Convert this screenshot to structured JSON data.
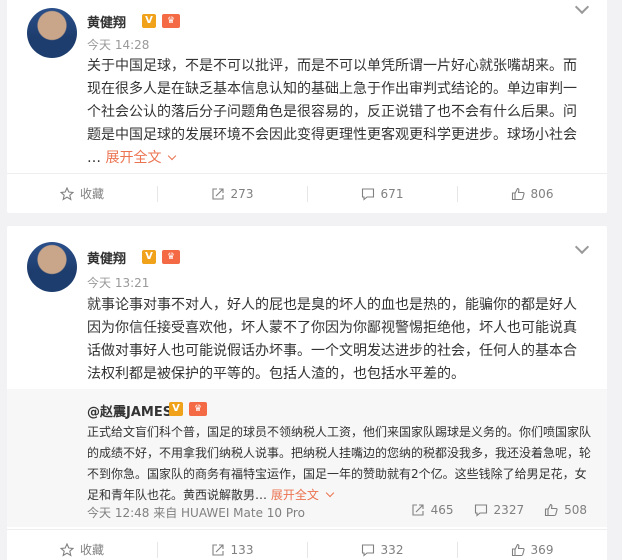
{
  "posts": [
    {
      "author": "黄健翔",
      "verified_badge": "V",
      "level_badge": "♛",
      "time": "今天 14:28",
      "content": "关于中国足球，不是不可以批评，而是不可以单凭所谓一片好心就张嘴胡来。而现在很多人是在缺乏基本信息认知的基础上急于作出审判式结论的。单边审判一个社会公认的落后分子问题角色是很容易的，反正说错了也不会有什么后果。问题是中国足球的发展环境不会因此变得更理性更客观更科学更进步。球场小社会",
      "ellipsis": "…",
      "expand_label": "展开全文",
      "actions": {
        "favorite": "收藏",
        "repost": "273",
        "comment": "671",
        "like": "806"
      }
    },
    {
      "author": "黄健翔",
      "verified_badge": "V",
      "level_badge": "♛",
      "time": "今天 13:21",
      "content": "就事论事对事不对人，好人的屁也是臭的坏人的血也是热的，能骗你的都是好人因为你信任接受喜欢他，坏人蒙不了你因为你鄙视警惕拒绝他，坏人也可能说真话做对事好人也可能说假话办坏事。一个文明发达进步的社会，任何人的基本合法权利都是被保护的平等的。包括人渣的，也包括水平差的。",
      "repost": {
        "author": "@赵震JAMES",
        "verified_badge": "V",
        "level_badge": "♛",
        "text": "正式给文盲们科个普，国足的球员不领纳税人工资，他们来国家队踢球是义务的。你们喷国家队的成绩不好，不用拿我们纳税人说事。把纳税人挂嘴边的您纳的税都没我多，我还没着急呢，轮不到你急。国家队的商务有福特宝运作，国足一年的赞助就有2个亿。这些钱除了给男足花，女足和青年队也花。黄西说解散男",
        "ellipsis": "…",
        "expand_label": "展开全文",
        "meta": "今天 12:48 来自 HUAWEI Mate 10 Pro",
        "stats": {
          "repost": "465",
          "comment": "2327",
          "like": "508"
        }
      },
      "actions": {
        "favorite": "收藏",
        "repost": "133",
        "comment": "332",
        "like": "369"
      }
    }
  ],
  "icons": {
    "favorite": "star-icon",
    "repost": "share-icon",
    "comment": "comment-icon",
    "like": "thumbs-up-icon",
    "more": "chevron-down-icon"
  },
  "colors": {
    "accent": "#eb7350",
    "verified": "#f0a21a",
    "background": "#f2f2f5"
  }
}
